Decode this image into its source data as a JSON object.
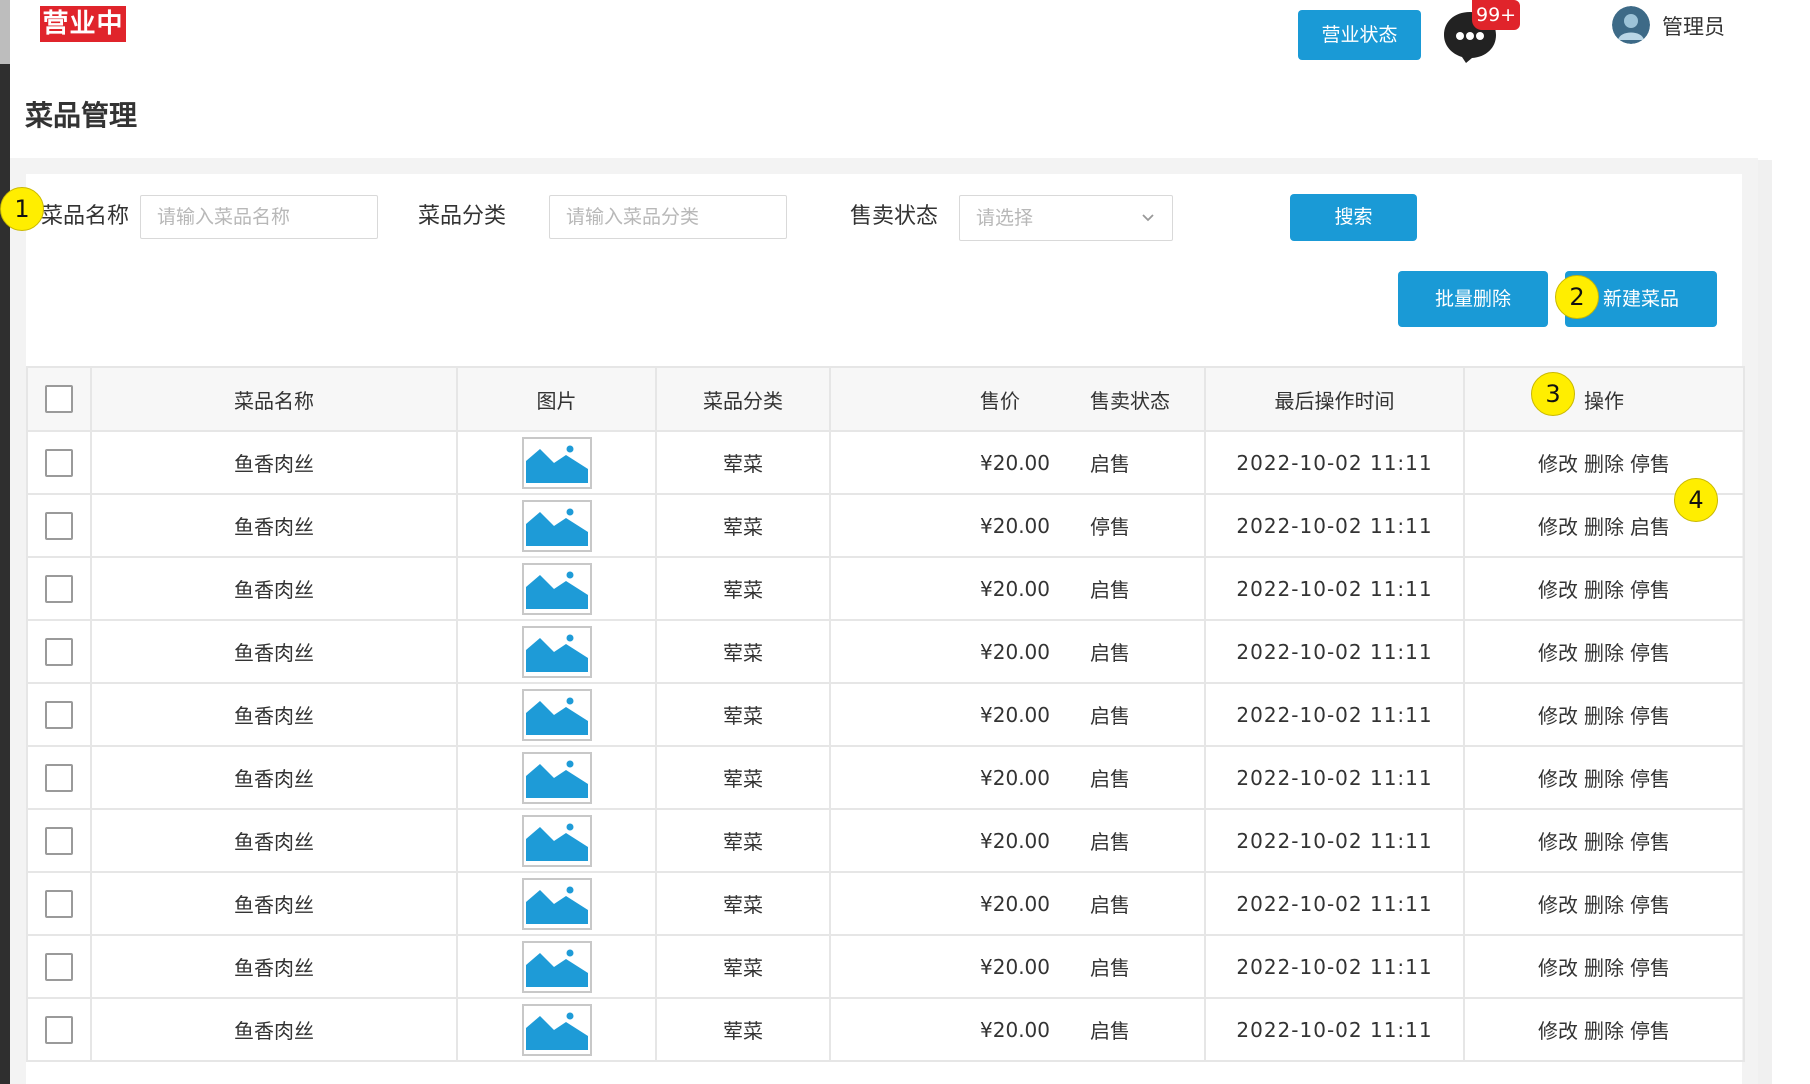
{
  "header": {
    "status_badge": "营业中",
    "biz_status_button": "营业状态",
    "message_count": "99+",
    "message_icon": "chat-bubble-icon",
    "user_name": "管理员",
    "avatar_icon": "avatar-icon"
  },
  "page": {
    "title": "菜品管理"
  },
  "filters": {
    "name_label": "菜品名称",
    "name_placeholder": "请输入菜品名称",
    "category_label": "菜品分类",
    "category_placeholder": "请输入菜品分类",
    "status_label": "售卖状态",
    "status_placeholder": "请选择",
    "search_button": "搜索"
  },
  "actions": {
    "bulk_delete": "批量删除",
    "new_dish": "新建菜品"
  },
  "markers": [
    "1",
    "2",
    "3",
    "4"
  ],
  "table": {
    "columns": [
      "菜品名称",
      "图片",
      "菜品分类",
      "售价",
      "售卖状态",
      "最后操作时间",
      "操作"
    ],
    "rows": [
      {
        "name": "鱼香肉丝",
        "category": "荤菜",
        "price": "¥20.00",
        "status": "启售",
        "time": "2022-10-02 11:11",
        "edit": "修改",
        "delete": "删除",
        "toggle": "停售"
      },
      {
        "name": "鱼香肉丝",
        "category": "荤菜",
        "price": "¥20.00",
        "status": "停售",
        "time": "2022-10-02 11:11",
        "edit": "修改",
        "delete": "删除",
        "toggle": "启售"
      },
      {
        "name": "鱼香肉丝",
        "category": "荤菜",
        "price": "¥20.00",
        "status": "启售",
        "time": "2022-10-02 11:11",
        "edit": "修改",
        "delete": "删除",
        "toggle": "停售"
      },
      {
        "name": "鱼香肉丝",
        "category": "荤菜",
        "price": "¥20.00",
        "status": "启售",
        "time": "2022-10-02 11:11",
        "edit": "修改",
        "delete": "删除",
        "toggle": "停售"
      },
      {
        "name": "鱼香肉丝",
        "category": "荤菜",
        "price": "¥20.00",
        "status": "启售",
        "time": "2022-10-02 11:11",
        "edit": "修改",
        "delete": "删除",
        "toggle": "停售"
      },
      {
        "name": "鱼香肉丝",
        "category": "荤菜",
        "price": "¥20.00",
        "status": "启售",
        "time": "2022-10-02 11:11",
        "edit": "修改",
        "delete": "删除",
        "toggle": "停售"
      },
      {
        "name": "鱼香肉丝",
        "category": "荤菜",
        "price": "¥20.00",
        "status": "启售",
        "time": "2022-10-02 11:11",
        "edit": "修改",
        "delete": "删除",
        "toggle": "停售"
      },
      {
        "name": "鱼香肉丝",
        "category": "荤菜",
        "price": "¥20.00",
        "status": "启售",
        "time": "2022-10-02 11:11",
        "edit": "修改",
        "delete": "删除",
        "toggle": "停售"
      },
      {
        "name": "鱼香肉丝",
        "category": "荤菜",
        "price": "¥20.00",
        "status": "启售",
        "time": "2022-10-02 11:11",
        "edit": "修改",
        "delete": "删除",
        "toggle": "停售"
      },
      {
        "name": "鱼香肉丝",
        "category": "荤菜",
        "price": "¥20.00",
        "status": "启售",
        "time": "2022-10-02 11:11",
        "edit": "修改",
        "delete": "删除",
        "toggle": "停售"
      }
    ]
  },
  "colors": {
    "primary": "#1a9ad6",
    "badge_red": "#e0242b",
    "marker_yellow": "#ffee00",
    "image_blue": "#1e9bd7"
  }
}
